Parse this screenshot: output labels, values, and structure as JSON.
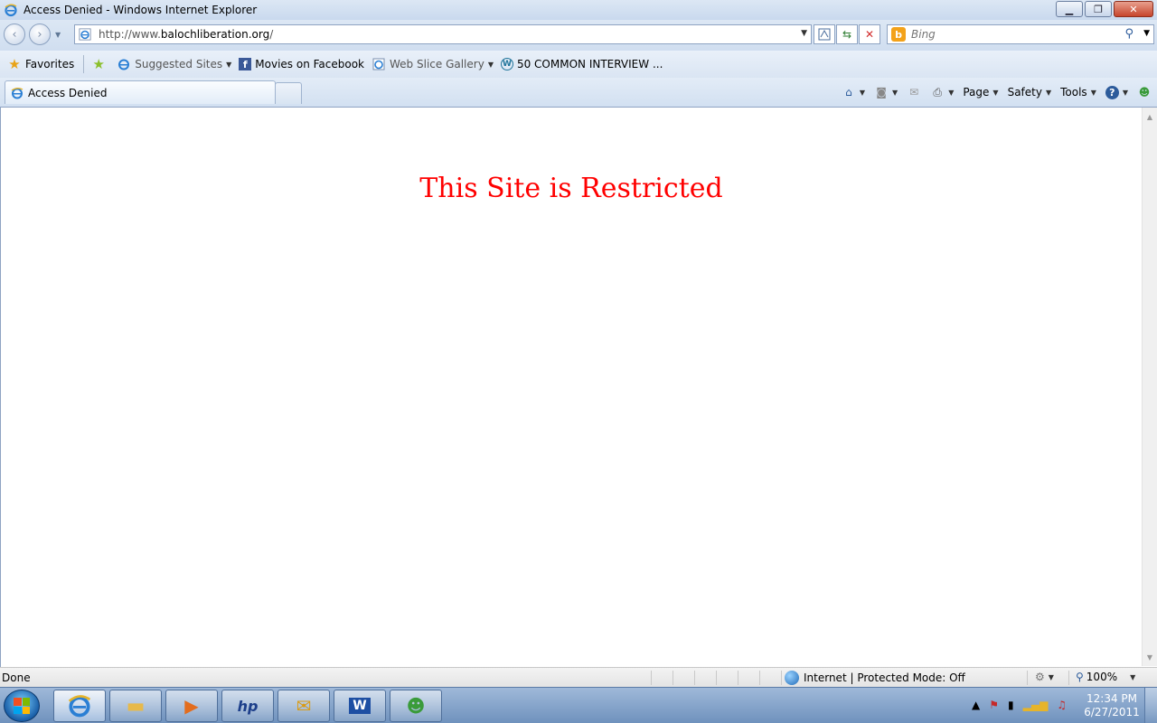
{
  "window": {
    "title": "Access Denied - Windows Internet Explorer",
    "buttons": {
      "minimize": "▁",
      "restore": "❐",
      "close": "✕"
    }
  },
  "navigation": {
    "back": "‹",
    "forward": "›",
    "url_prefix": "http://www.",
    "url_domain": "balochliberation.org",
    "url_suffix": "/",
    "search_placeholder": "Bing",
    "search_provider_letter": "b"
  },
  "favorites_bar": {
    "favorites_label": "Favorites",
    "items": [
      {
        "label": "Suggested Sites",
        "icon": "ie-icon",
        "has_dropdown": true
      },
      {
        "label": "Movies on Facebook",
        "icon": "facebook-icon",
        "has_dropdown": false
      },
      {
        "label": "Web Slice Gallery",
        "icon": "ie-icon",
        "has_dropdown": true
      },
      {
        "label": "50 COMMON INTERVIEW ...",
        "icon": "wordpress-icon",
        "has_dropdown": false
      }
    ]
  },
  "tab": {
    "label": "Access Denied"
  },
  "command_bar": {
    "page_label": "Page",
    "safety_label": "Safety",
    "tools_label": "Tools"
  },
  "page": {
    "message": "This Site is Restricted",
    "message_color": "#ff0000"
  },
  "status_bar": {
    "status_text": "Done",
    "zone_text": "Internet | Protected Mode: Off",
    "zoom_text": "100%"
  },
  "taskbar": {
    "clock_time": "12:34 PM",
    "clock_date": "6/27/2011"
  }
}
